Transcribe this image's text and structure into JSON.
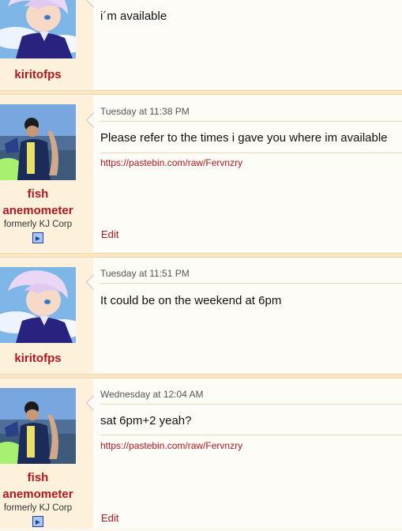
{
  "posts": [
    {
      "username": "kiritofps",
      "date": "",
      "message": "i´m available"
    },
    {
      "username_line1": "fish",
      "username_line2": "anemometer",
      "user_title": "formerly KJ Corp",
      "date": "Tuesday at 11:38 PM",
      "message": "Please refer to the times i gave you where im available",
      "link": "https://pastebin.com/raw/Fervnzry",
      "edit_label": "Edit"
    },
    {
      "username": "kiritofps",
      "date": "Tuesday at 11:51 PM",
      "message": "It could be on the weekend at 6pm"
    },
    {
      "username_line1": "fish",
      "username_line2": "anemometer",
      "user_title": "formerly KJ Corp",
      "date": "Wednesday at 12:04 AM",
      "message": "sat 6pm+2 yeah?",
      "link": "https://pastebin.com/raw/Fervnzry",
      "edit_label": "Edit"
    }
  ],
  "colors": {
    "username": "#b3151f",
    "link": "#b3151f",
    "userpane": "#fdf1dc",
    "separator": "#fbe6c6"
  }
}
